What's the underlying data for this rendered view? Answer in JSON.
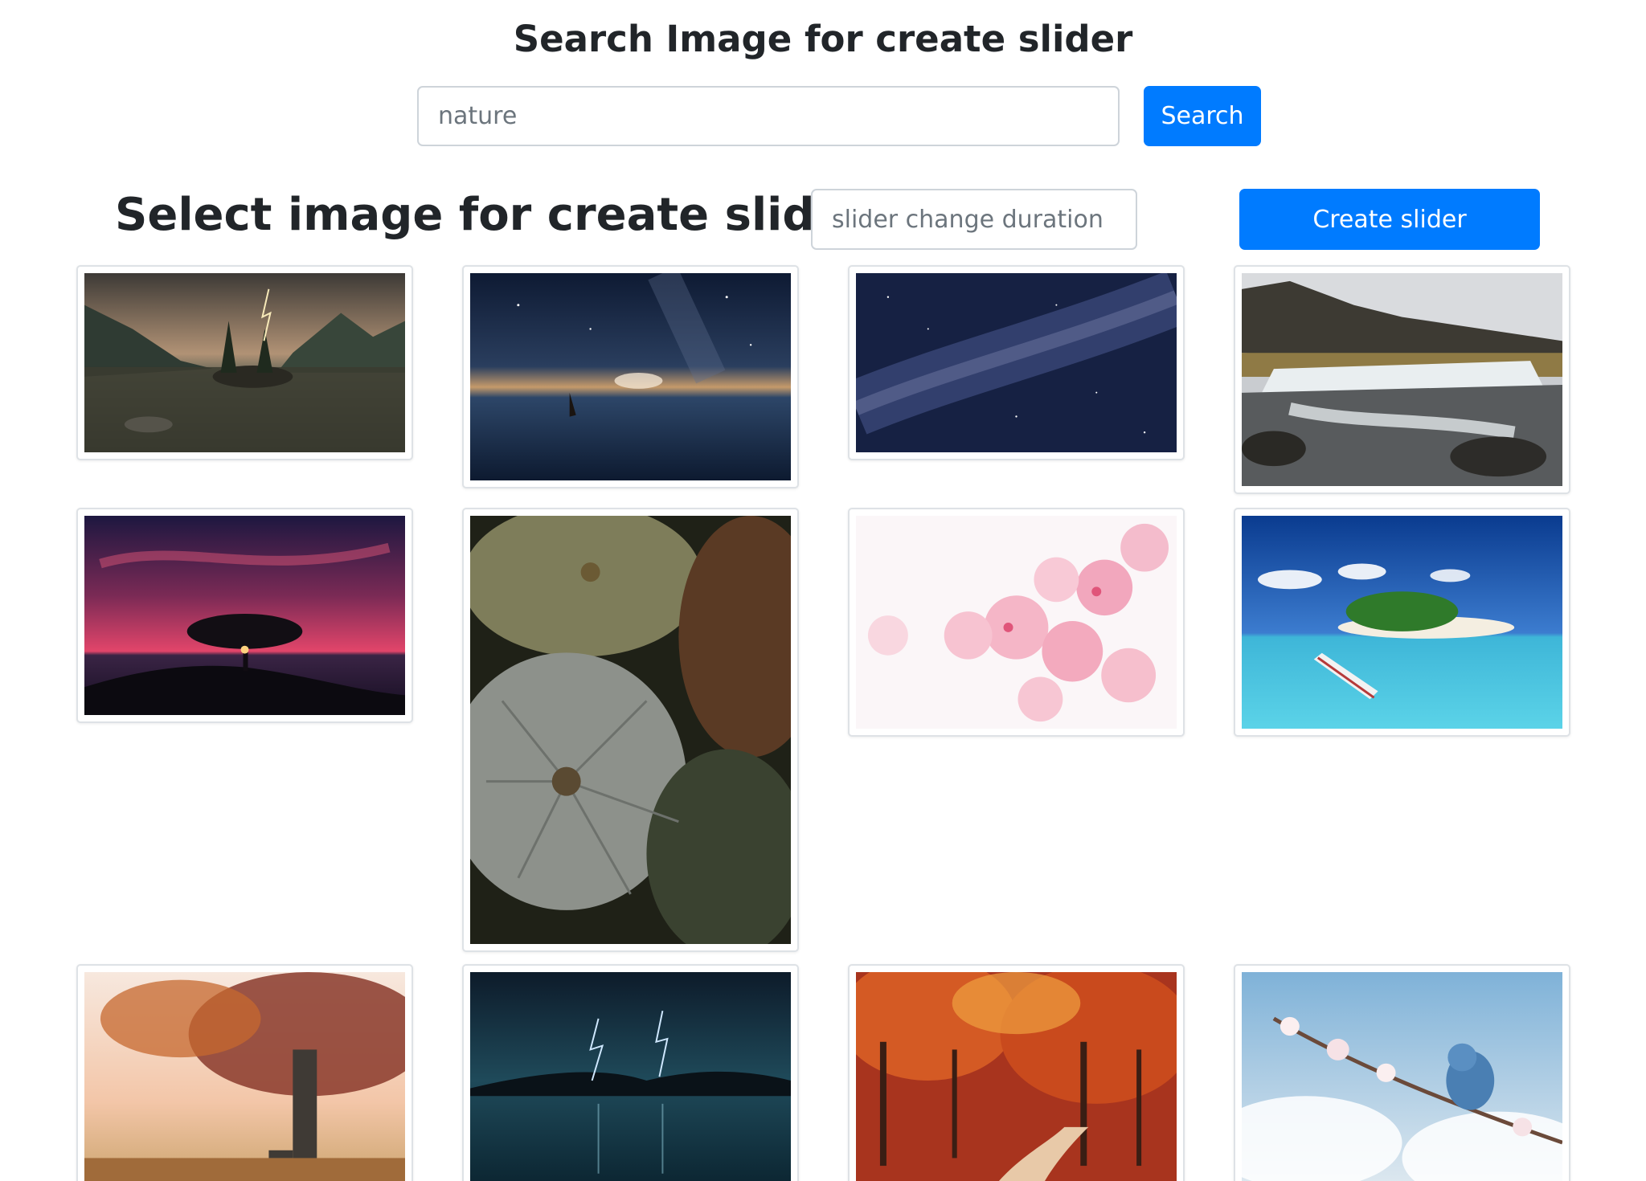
{
  "header": {
    "title": "Search Image for create slider",
    "search_value": "nature",
    "search_button": "Search"
  },
  "slider_controls": {
    "title": "Select image for create slider",
    "duration_placeholder": "slider change duration",
    "create_button": "Create slider"
  },
  "gallery": {
    "images": [
      {
        "subject": "lake-island-lightning"
      },
      {
        "subject": "starry-sea-sailboat"
      },
      {
        "subject": "milky-way"
      },
      {
        "subject": "river-waterfall"
      },
      {
        "subject": "red-sky-tree-sunset"
      },
      {
        "subject": "pumpkins"
      },
      {
        "subject": "cherry-blossom"
      },
      {
        "subject": "tropical-island-boat"
      },
      {
        "subject": "autumn-tree-bench"
      },
      {
        "subject": "lightning-over-water"
      },
      {
        "subject": "autumn-forest-path"
      },
      {
        "subject": "blue-bird-blossom"
      }
    ]
  }
}
